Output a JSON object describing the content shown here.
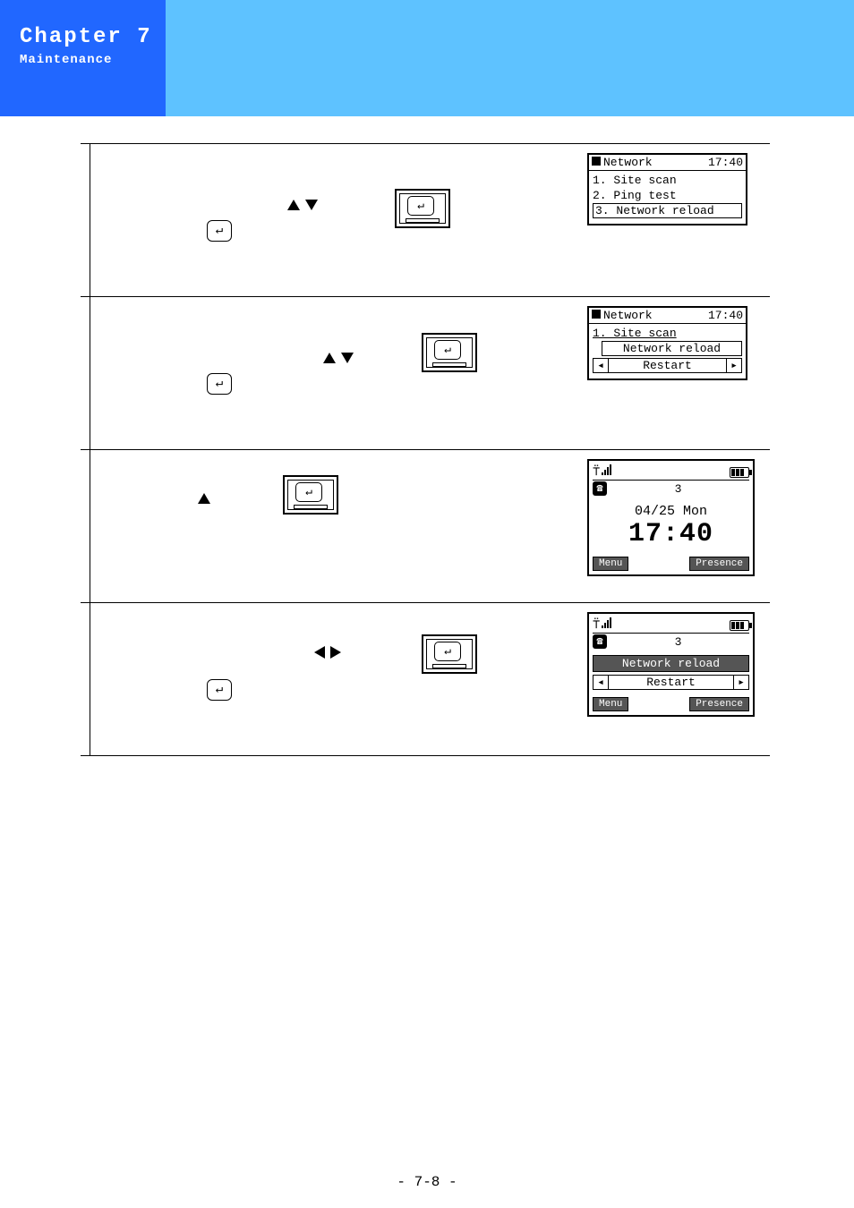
{
  "header": {
    "chapter": "Chapter 7",
    "section": "Maintenance"
  },
  "page_number": "- 7-8 -",
  "steps": [
    {
      "screen": {
        "type": "menu",
        "title": "Network",
        "clock": "17:40",
        "items": [
          {
            "text": "1. Site scan",
            "sel": false
          },
          {
            "text": "2. Ping test",
            "sel": false
          },
          {
            "text": "3. Network reload",
            "sel": true
          }
        ]
      }
    },
    {
      "screen": {
        "type": "menu",
        "title": "Network",
        "clock": "17:40",
        "line1": "1. Site scan",
        "dialog": "Network reload",
        "nav": "Restart"
      }
    },
    {
      "screen": {
        "type": "home",
        "id": "3",
        "date": "04/25 Mon",
        "time": "17:40",
        "sk_left": "Menu",
        "sk_right": "Presence"
      }
    },
    {
      "screen": {
        "type": "home-dialog",
        "id": "3",
        "dialog": "Network reload",
        "nav": "Restart",
        "sk_left": "Menu",
        "sk_right": "Presence"
      }
    }
  ]
}
